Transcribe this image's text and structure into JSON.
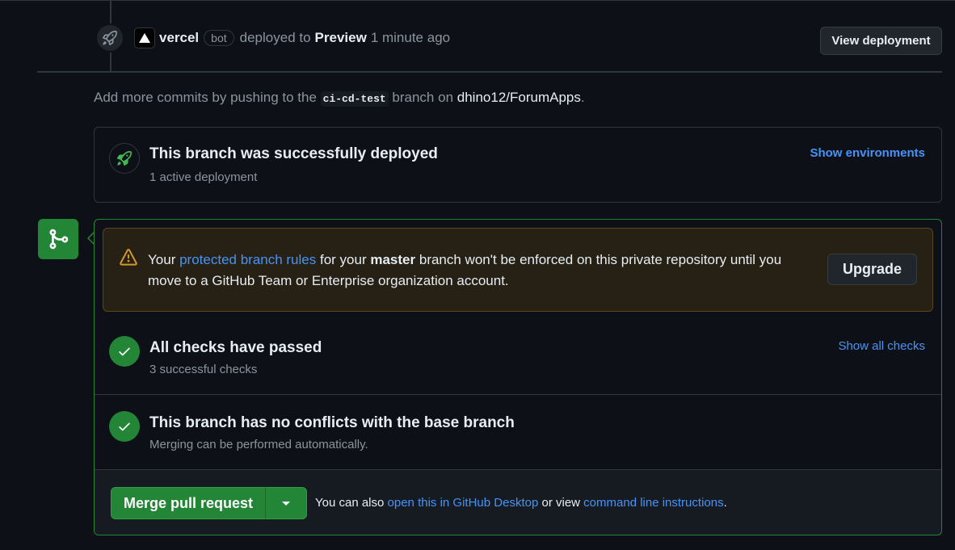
{
  "deploy_event": {
    "actor": "vercel",
    "bot_label": "bot",
    "action": "deployed to",
    "environment": "Preview",
    "time": "1 minute ago",
    "view_button": "View deployment"
  },
  "add_commits": {
    "prefix": "Add more commits by pushing to the",
    "branch": "ci-cd-test",
    "middle": "branch on",
    "repo": "dhino12/ForumApps",
    "suffix": "."
  },
  "deployments": {
    "title": "This branch was successfully deployed",
    "subtitle": "1 active deployment",
    "show_link": "Show environments"
  },
  "warning": {
    "prefix": "Your",
    "link": "protected branch rules",
    "mid1": "for your",
    "branch": "master",
    "rest": "branch won't be enforced on this private repository until you move to a GitHub Team or Enterprise organization account.",
    "button": "Upgrade"
  },
  "checks": {
    "title": "All checks have passed",
    "subtitle": "3 successful checks",
    "link": "Show all checks"
  },
  "conflicts": {
    "title": "This branch has no conflicts with the base branch",
    "subtitle": "Merging can be performed automatically."
  },
  "merge": {
    "button": "Merge pull request",
    "text_prefix": "You can also",
    "desktop_link": "open this in GitHub Desktop",
    "text_mid": "or view",
    "cli_link": "command line instructions",
    "text_suffix": "."
  },
  "colors": {
    "background": "#0d1117",
    "success": "#238636",
    "link": "#4493f8",
    "warning": "#d29922"
  }
}
